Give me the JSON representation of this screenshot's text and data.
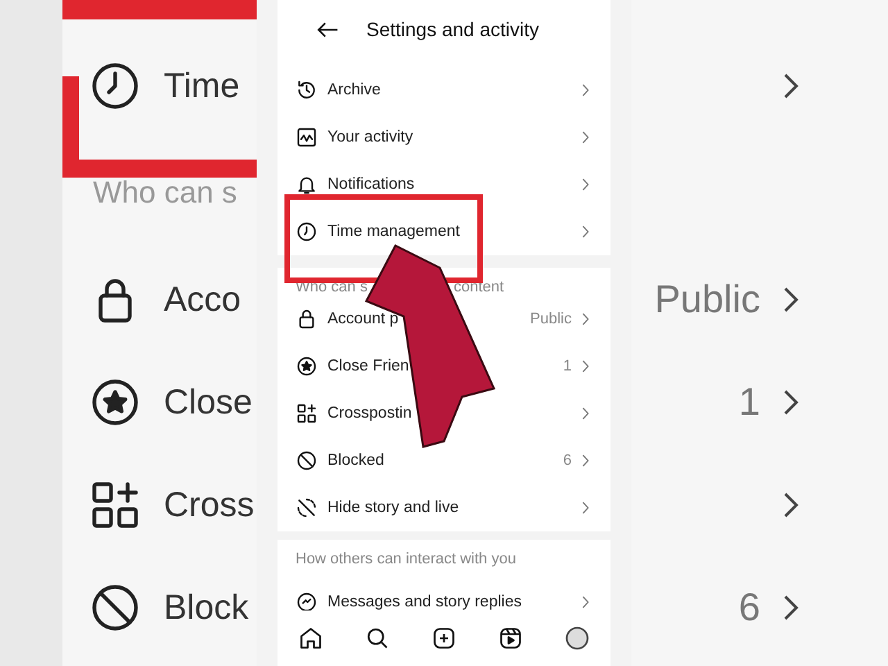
{
  "backdrop": {
    "rows": [
      {
        "kind": "clock",
        "label": "Time"
      },
      {
        "kind": "header",
        "label": "Who can s"
      },
      {
        "kind": "lock",
        "label": "Acco",
        "value": "Public"
      },
      {
        "kind": "star",
        "label": "Close",
        "value": "1"
      },
      {
        "kind": "grid",
        "label": "Cross"
      },
      {
        "kind": "blocked",
        "label": "Block",
        "value": "6"
      }
    ]
  },
  "phone": {
    "title": "Settings and activity",
    "sections": [
      {
        "items": [
          {
            "kind": "archive",
            "label": "Archive"
          },
          {
            "kind": "activity",
            "label": "Your activity"
          },
          {
            "kind": "bell",
            "label": "Notifications"
          },
          {
            "kind": "clock",
            "label": "Time management"
          }
        ]
      },
      {
        "header": [
          "Who can s",
          "content"
        ],
        "items": [
          {
            "kind": "lock",
            "label": "Account p",
            "value": "Public"
          },
          {
            "kind": "star",
            "label": "Close Frien",
            "value": "1"
          },
          {
            "kind": "grid",
            "label": "Crosspostin"
          },
          {
            "kind": "blocked",
            "label": "Blocked",
            "value": "6"
          },
          {
            "kind": "hide",
            "label": "Hide story and live"
          }
        ]
      },
      {
        "header": [
          "How others can interact with you"
        ],
        "items": [
          {
            "kind": "message",
            "label": "Messages and story replies"
          }
        ]
      }
    ],
    "nav": [
      {
        "kind": "home"
      },
      {
        "kind": "search"
      },
      {
        "kind": "create"
      },
      {
        "kind": "reels"
      },
      {
        "kind": "profile"
      }
    ]
  }
}
